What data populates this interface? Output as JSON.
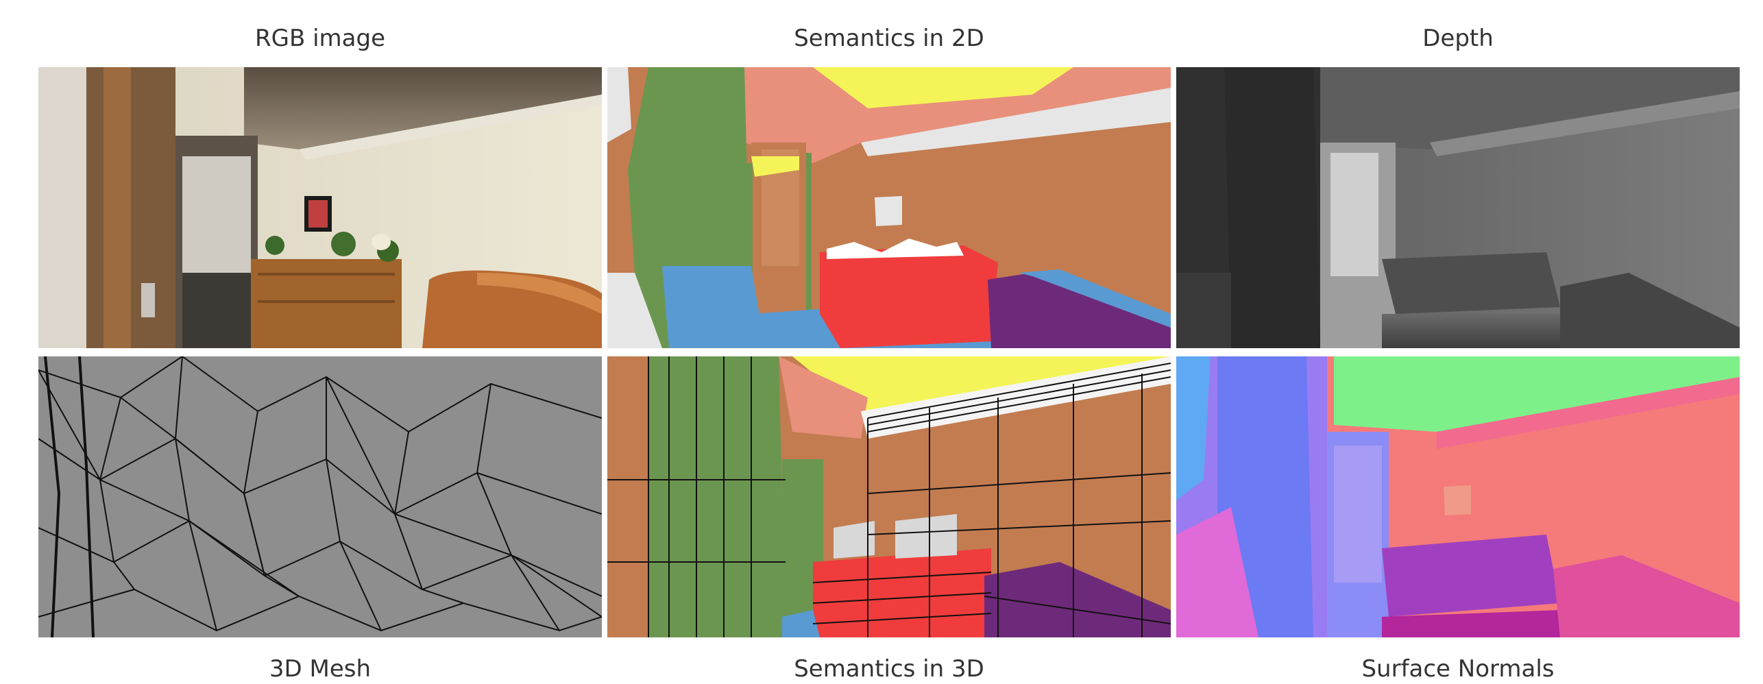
{
  "figure": {
    "panels": [
      {
        "id": "rgb",
        "label": "RGB image",
        "icon": "rgb-photo-icon"
      },
      {
        "id": "semantics2d",
        "label": "Semantics in 2D",
        "icon": "semantic-segmentation-icon"
      },
      {
        "id": "depth",
        "label": "Depth",
        "icon": "depth-map-icon"
      },
      {
        "id": "mesh",
        "label": "3D Mesh",
        "icon": "wireframe-mesh-icon"
      },
      {
        "id": "semantics3d",
        "label": "Semantics in 3D",
        "icon": "semantic-3d-icon"
      },
      {
        "id": "normals",
        "label": "Surface Normals",
        "icon": "surface-normals-icon"
      }
    ]
  }
}
